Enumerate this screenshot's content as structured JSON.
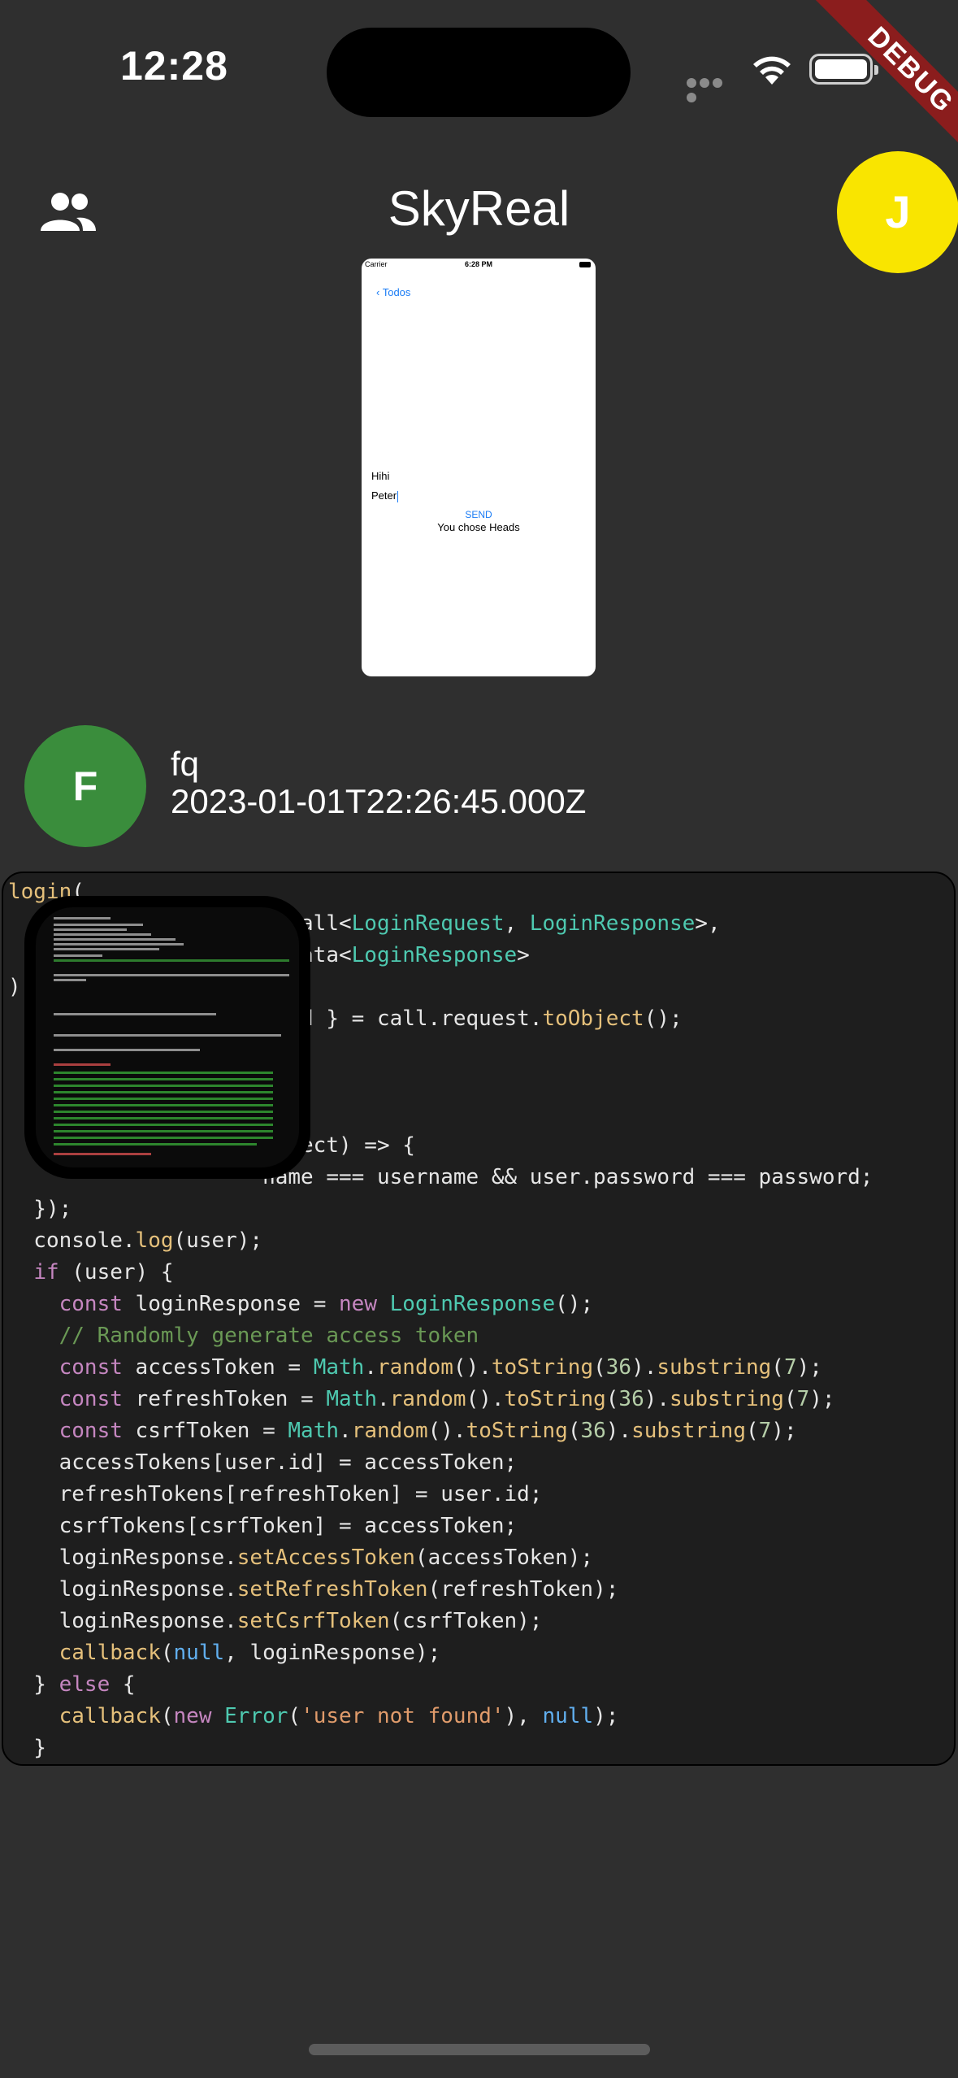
{
  "status_bar": {
    "time": "12:28"
  },
  "debug_banner": "DEBUG",
  "app_bar": {
    "title": "SkyReal",
    "avatar_initial": "J",
    "left_icon": "people-icon"
  },
  "embedded_screenshot": {
    "carrier": "Carrier",
    "time": "6:28 PM",
    "back_label": "Todos",
    "line1": "Hihi",
    "line2": "Peter",
    "send_label": "SEND",
    "result_text": "You chose Heads"
  },
  "post": {
    "avatar_initial": "F",
    "username": "fq",
    "timestamp": "2023-01-01T22:26:45.000Z"
  },
  "code": {
    "lines": [
      "login(",
      "                    ryCall<LoginRequest, LoginResponse>,",
      "                    ryData<LoginResponse>",
      "):",
      "                    word } = call.request.toObject();",
      "",
      "",
      "",
      "                    Object) => {",
      "                    name === username && user.password === password;",
      "  });",
      "  console.log(user);",
      "  if (user) {",
      "    const loginResponse = new LoginResponse();",
      "    // Randomly generate access token",
      "    const accessToken = Math.random().toString(36).substring(7);",
      "    const refreshToken = Math.random().toString(36).substring(7);",
      "    const csrfToken = Math.random().toString(36).substring(7);",
      "    accessTokens[user.id] = accessToken;",
      "    refreshTokens[refreshToken] = user.id;",
      "    csrfTokens[csrfToken] = accessToken;",
      "    loginResponse.setAccessToken(accessToken);",
      "    loginResponse.setRefreshToken(refreshToken);",
      "    loginResponse.setCsrfToken(csrfToken);",
      "    callback(null, loginResponse);",
      "  } else {",
      "    callback(new Error('user not found'), null);",
      "  }"
    ]
  },
  "colors": {
    "background": "#2f2f2f",
    "avatar_j": "#f9e500",
    "avatar_f": "#3a8d3c",
    "debug": "#8b1d1d",
    "code_bg": "#1e1e1e"
  }
}
